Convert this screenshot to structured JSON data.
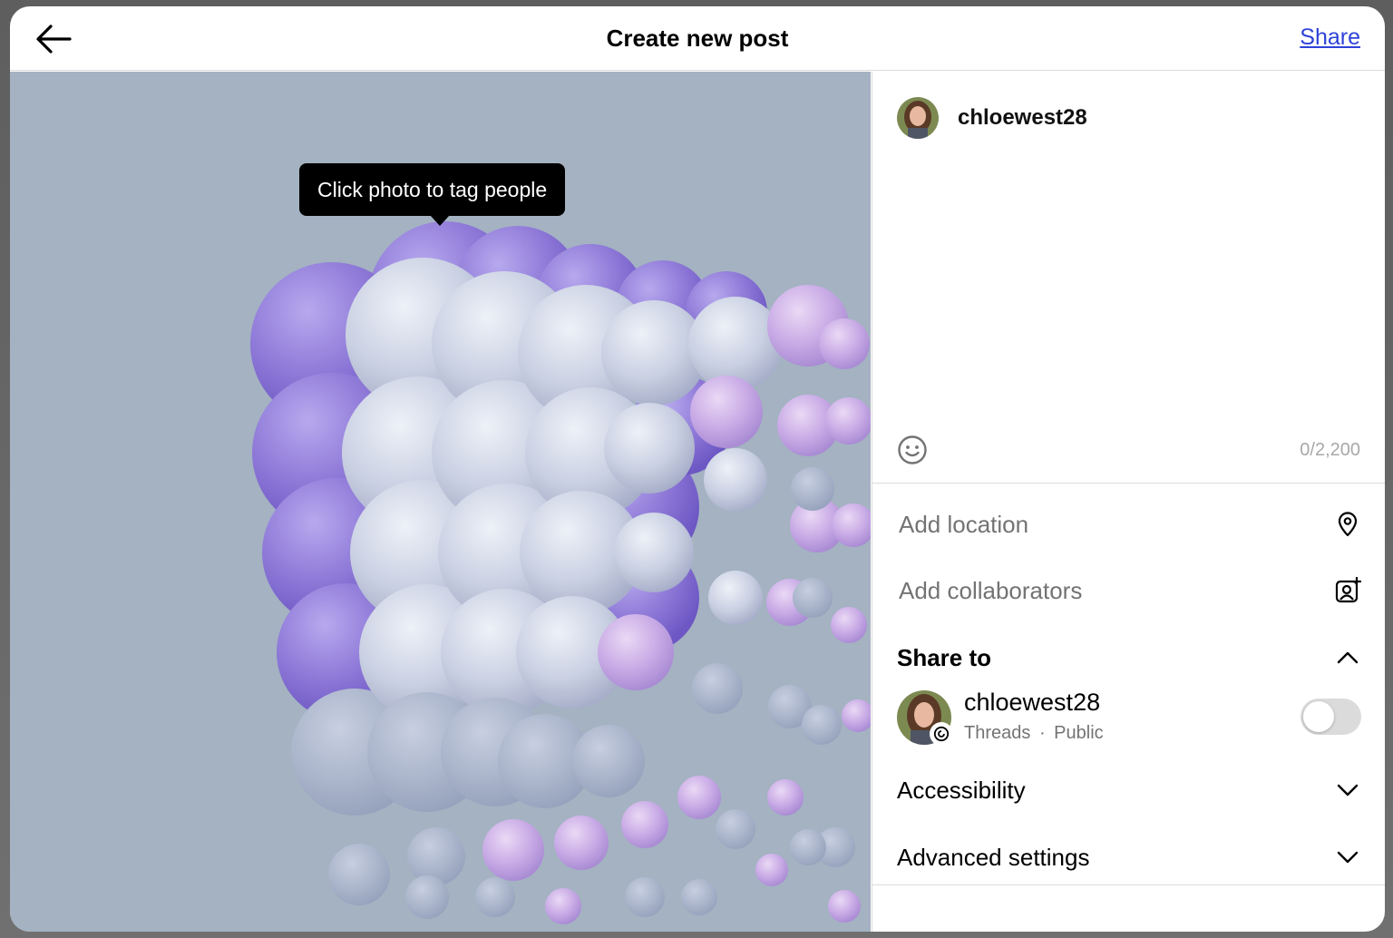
{
  "header": {
    "title": "Create new post",
    "share_label": "Share",
    "back_icon": "arrow-left-icon"
  },
  "photo": {
    "tooltip": "Click photo to tag people",
    "subject": "purple-sphere-grid-render"
  },
  "composer": {
    "username": "chloewest28",
    "caption_value": "",
    "emoji_icon": "smiley-icon",
    "char_counter": "0/2,200"
  },
  "options": {
    "location_label": "Add location",
    "location_icon": "map-pin-icon",
    "collaborators_label": "Add collaborators",
    "collaborators_icon": "add-person-icon",
    "share_to": {
      "title": "Share to",
      "expanded": true,
      "account_name": "chloewest28",
      "platform": "Threads",
      "separator": "·",
      "visibility": "Public",
      "toggle_on": false
    },
    "accessibility_label": "Accessibility",
    "advanced_label": "Advanced settings"
  },
  "colors": {
    "link": "#2e43d9",
    "muted_text": "#737373",
    "divider": "#dbdbdb",
    "photo_bg": "#a4b2c2",
    "sphere_purple": "#8f7ad8",
    "sphere_light": "#d4dbe9"
  }
}
